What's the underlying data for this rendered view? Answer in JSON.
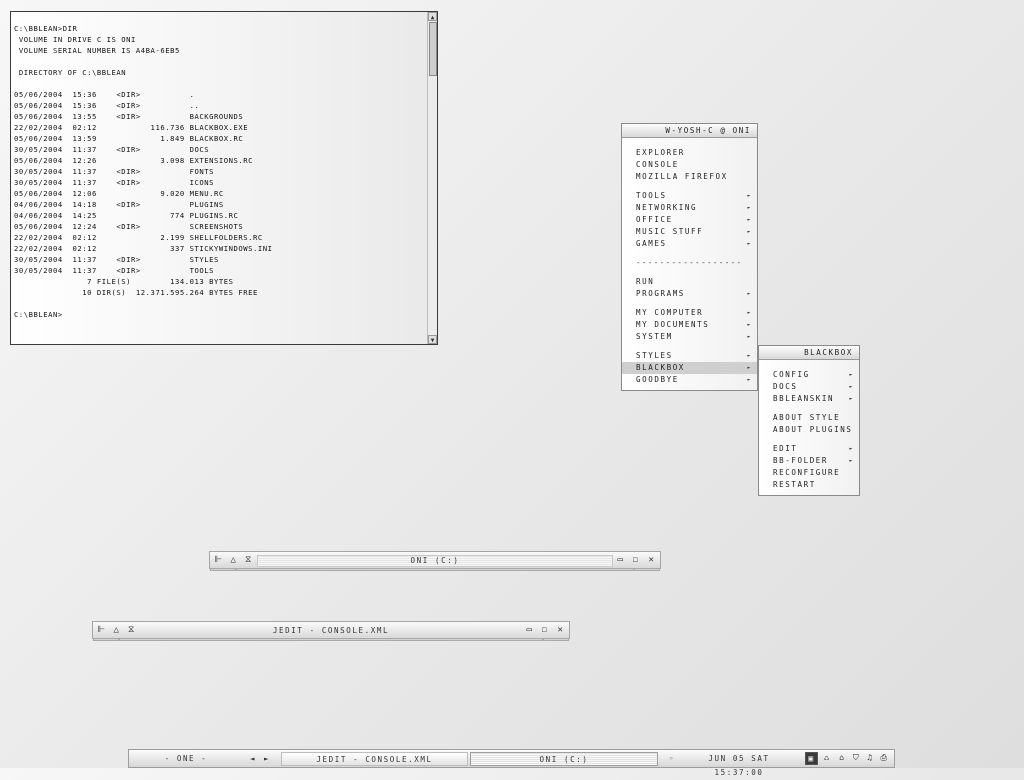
{
  "console": {
    "lines": [
      "C:\\BBLEAN>DIR",
      " VOLUME IN DRIVE C IS ONI",
      " VOLUME SERIAL NUMBER IS A4BA-6EB5",
      "",
      " DIRECTORY OF C:\\BBLEAN",
      "",
      "05/06/2004  15:36    <DIR>          .",
      "05/06/2004  15:36    <DIR>          ..",
      "05/06/2004  13:55    <DIR>          BACKGROUNDS",
      "22/02/2004  02:12           116.736 BLACKBOX.EXE",
      "05/06/2004  13:59             1.849 BLACKBOX.RC",
      "30/05/2004  11:37    <DIR>          DOCS",
      "05/06/2004  12:26             3.098 EXTENSIONS.RC",
      "30/05/2004  11:37    <DIR>          FONTS",
      "30/05/2004  11:37    <DIR>          ICONS",
      "05/06/2004  12:06             9.020 MENU.RC",
      "04/06/2004  14:18    <DIR>          PLUGINS",
      "04/06/2004  14:25               774 PLUGINS.RC",
      "05/06/2004  12:24    <DIR>          SCREENSHOTS",
      "22/02/2004  02:12             2.199 SHELLFOLDERS.RC",
      "22/02/2004  02:12               337 STICKYWINDOWS.INI",
      "30/05/2004  11:37    <DIR>          STYLES",
      "30/05/2004  11:37    <DIR>          TOOLS",
      "               7 FILE(S)        134.013 BYTES",
      "              10 DIR(S)  12.371.595.264 BYTES FREE",
      "",
      "C:\\BBLEAN>"
    ],
    "scroll_up": "▲",
    "scroll_down": "▼"
  },
  "main_menu": {
    "title": "W-YOSH-C @ ONI",
    "items": [
      {
        "label": "EXPLORER",
        "sub": ""
      },
      {
        "label": "CONSOLE",
        "sub": ""
      },
      {
        "label": "MOZILLA FIREFOX",
        "sub": ""
      },
      {
        "label": "TOOLS",
        "sub": "►"
      },
      {
        "label": "NETWORKING",
        "sub": "►"
      },
      {
        "label": "OFFICE",
        "sub": "►"
      },
      {
        "label": "MUSIC STUFF",
        "sub": "►"
      },
      {
        "label": "GAMES",
        "sub": "►"
      },
      {
        "label": "RUN",
        "sub": ""
      },
      {
        "label": "PROGRAMS",
        "sub": "►"
      },
      {
        "label": "MY COMPUTER",
        "sub": "►"
      },
      {
        "label": "MY DOCUMENTS",
        "sub": "►"
      },
      {
        "label": "SYSTEM",
        "sub": "►"
      },
      {
        "label": "STYLES",
        "sub": "►"
      },
      {
        "label": "BLACKBOX",
        "sub": "►"
      },
      {
        "label": "GOODBYE",
        "sub": "►"
      }
    ],
    "separator": "------------------"
  },
  "blackbox_menu": {
    "title": "BLACKBOX",
    "items": [
      {
        "label": "CONFIG",
        "sub": "►"
      },
      {
        "label": "DOCS",
        "sub": "►"
      },
      {
        "label": "BBLEANSKIN",
        "sub": "►"
      },
      {
        "label": "ABOUT STYLE",
        "sub": ""
      },
      {
        "label": "ABOUT PLUGINS",
        "sub": ""
      },
      {
        "label": "EDIT",
        "sub": "►"
      },
      {
        "label": "BB-FOLDER",
        "sub": "►"
      },
      {
        "label": "RECONFIGURE",
        "sub": ""
      },
      {
        "label": "RESTART",
        "sub": ""
      }
    ]
  },
  "windows": {
    "oni": {
      "title": "ONI (C:)"
    },
    "jedit": {
      "title": "JEDIT - CONSOLE.XML"
    }
  },
  "toolbar": {
    "workspace": "- ONE -",
    "prev": "◄",
    "next": "►",
    "tasks": [
      "JEDIT - CONSOLE.XML",
      "ONI (C:)"
    ],
    "clock": "JUN 05 SAT 15:37:00",
    "clock_marker": "◦"
  }
}
